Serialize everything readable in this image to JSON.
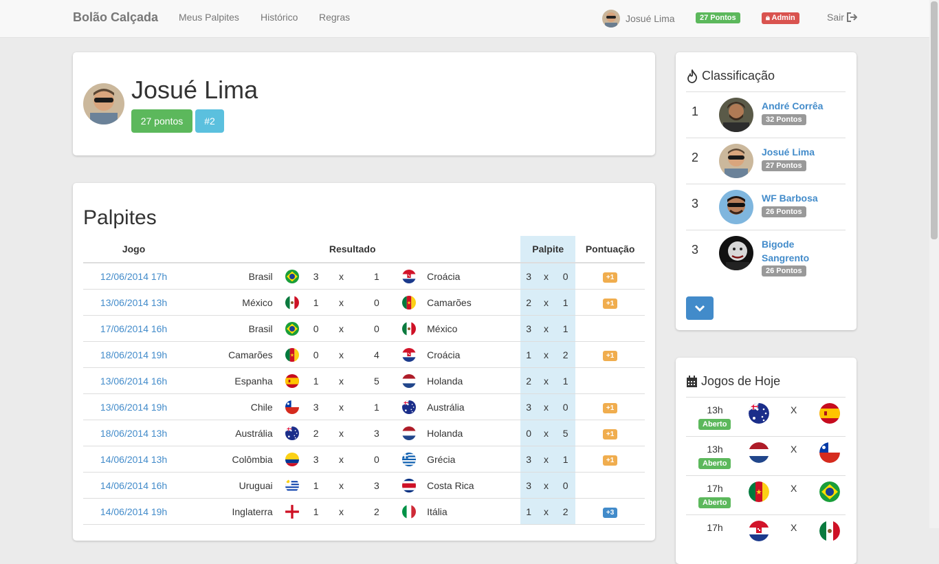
{
  "nav": {
    "brand": "Bolão Calçada",
    "links": [
      "Meus Palpites",
      "Histórico",
      "Regras"
    ],
    "user_name": "Josué Lima",
    "points_badge": "27 Pontos",
    "admin_badge": "Admin",
    "logout": "Sair"
  },
  "profile": {
    "name": "Josué Lima",
    "points_button": "27 pontos",
    "rank_button": "#2"
  },
  "palpites": {
    "title": "Palpites",
    "headers": {
      "jogo": "Jogo",
      "resultado": "Resultado",
      "palpite": "Palpite",
      "pontuacao": "Pontuação"
    },
    "rows": [
      {
        "date": "12/06/2014 17h",
        "home": "Brasil",
        "home_flag": "brazil",
        "hs": "3",
        "as": "1",
        "away": "Croácia",
        "away_flag": "croatia",
        "ph": "3",
        "pa": "0",
        "pts": "+1",
        "pts_color": "#f0ad4e"
      },
      {
        "date": "13/06/2014 13h",
        "home": "México",
        "home_flag": "mexico",
        "hs": "1",
        "as": "0",
        "away": "Camarões",
        "away_flag": "cameroon",
        "ph": "2",
        "pa": "1",
        "pts": "+1",
        "pts_color": "#f0ad4e"
      },
      {
        "date": "17/06/2014 16h",
        "home": "Brasil",
        "home_flag": "brazil",
        "hs": "0",
        "as": "0",
        "away": "México",
        "away_flag": "mexico",
        "ph": "3",
        "pa": "1",
        "pts": "",
        "pts_color": ""
      },
      {
        "date": "18/06/2014 19h",
        "home": "Camarões",
        "home_flag": "cameroon",
        "hs": "0",
        "as": "4",
        "away": "Croácia",
        "away_flag": "croatia",
        "ph": "1",
        "pa": "2",
        "pts": "+1",
        "pts_color": "#f0ad4e"
      },
      {
        "date": "13/06/2014 16h",
        "home": "Espanha",
        "home_flag": "spain",
        "hs": "1",
        "as": "5",
        "away": "Holanda",
        "away_flag": "netherlands",
        "ph": "2",
        "pa": "1",
        "pts": "",
        "pts_color": ""
      },
      {
        "date": "13/06/2014 19h",
        "home": "Chile",
        "home_flag": "chile",
        "hs": "3",
        "as": "1",
        "away": "Austrália",
        "away_flag": "australia",
        "ph": "3",
        "pa": "0",
        "pts": "+1",
        "pts_color": "#f0ad4e"
      },
      {
        "date": "18/06/2014 13h",
        "home": "Austrália",
        "home_flag": "australia",
        "hs": "2",
        "as": "3",
        "away": "Holanda",
        "away_flag": "netherlands",
        "ph": "0",
        "pa": "5",
        "pts": "+1",
        "pts_color": "#f0ad4e"
      },
      {
        "date": "14/06/2014 13h",
        "home": "Colômbia",
        "home_flag": "colombia",
        "hs": "3",
        "as": "0",
        "away": "Grécia",
        "away_flag": "greece",
        "ph": "3",
        "pa": "1",
        "pts": "+1",
        "pts_color": "#f0ad4e"
      },
      {
        "date": "14/06/2014 16h",
        "home": "Uruguai",
        "home_flag": "uruguay",
        "hs": "1",
        "as": "3",
        "away": "Costa Rica",
        "away_flag": "costarica",
        "ph": "3",
        "pa": "0",
        "pts": "",
        "pts_color": ""
      },
      {
        "date": "14/06/2014 19h",
        "home": "Inglaterra",
        "home_flag": "england",
        "hs": "1",
        "as": "2",
        "away": "Itália",
        "away_flag": "italy",
        "ph": "1",
        "pa": "2",
        "pts": "+3",
        "pts_color": "#428bca"
      }
    ]
  },
  "classificacao": {
    "title": "Classificação",
    "entries": [
      {
        "pos": "1",
        "name": "André Corrêa",
        "points": "32 Pontos"
      },
      {
        "pos": "2",
        "name": "Josué Lima",
        "points": "27 Pontos"
      },
      {
        "pos": "3",
        "name": "WF Barbosa",
        "points": "26 Pontos"
      },
      {
        "pos": "3",
        "name": "Bigode Sangrento",
        "points": "26 Pontos"
      }
    ]
  },
  "jogos_hoje": {
    "title": "Jogos de Hoje",
    "games": [
      {
        "time": "13h",
        "status": "Aberto",
        "home_flag": "australia",
        "away_flag": "spain",
        "x": "X"
      },
      {
        "time": "13h",
        "status": "Aberto",
        "home_flag": "netherlands",
        "away_flag": "chile",
        "x": "X"
      },
      {
        "time": "17h",
        "status": "Aberto",
        "home_flag": "cameroon",
        "away_flag": "brazil",
        "x": "X"
      },
      {
        "time": "17h",
        "status": "",
        "home_flag": "croatia",
        "away_flag": "mexico",
        "x": "X"
      }
    ]
  },
  "colors": {
    "primary": "#428bca",
    "success": "#5cb85c",
    "info": "#5bc0de",
    "danger": "#d9534f",
    "warning": "#f0ad4e"
  }
}
